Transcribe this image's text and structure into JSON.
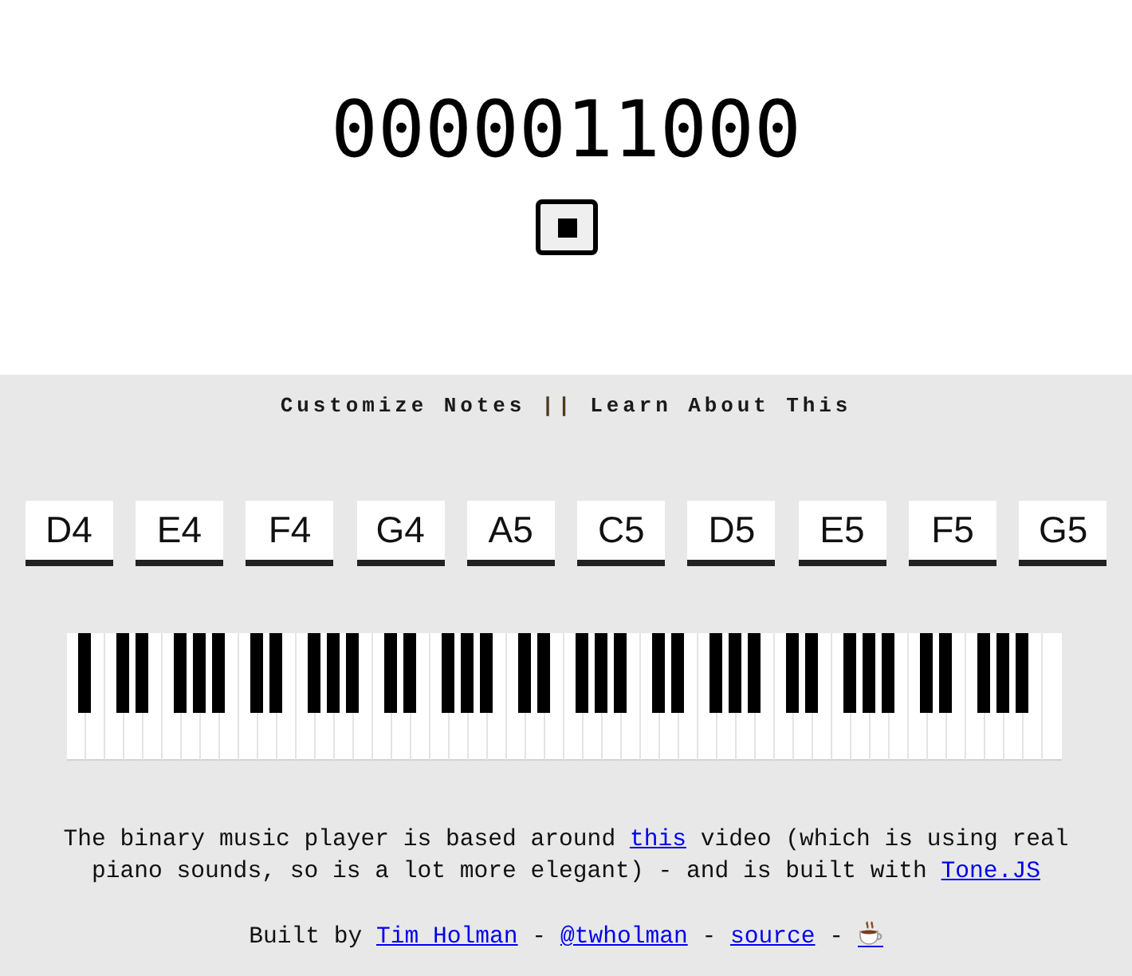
{
  "player": {
    "binary": "0000011000",
    "playing": true
  },
  "nav": [
    {
      "kind": "link",
      "label": "Customize Notes"
    },
    {
      "kind": "separator",
      "label": "||"
    },
    {
      "kind": "link",
      "label": "Learn About This"
    }
  ],
  "notes": [
    "D4",
    "E4",
    "F4",
    "G4",
    "A5",
    "C5",
    "D5",
    "E5",
    "F5",
    "G5"
  ],
  "piano": {
    "keys": [
      {
        "kind": "natural"
      },
      {
        "kind": "sharp"
      },
      {
        "kind": "natural"
      },
      {
        "kind": "natural"
      },
      {
        "kind": "sharp"
      },
      {
        "kind": "natural"
      },
      {
        "kind": "sharp"
      },
      {
        "kind": "natural"
      },
      {
        "kind": "natural"
      },
      {
        "kind": "sharp"
      },
      {
        "kind": "natural"
      },
      {
        "kind": "sharp"
      },
      {
        "kind": "natural"
      },
      {
        "kind": "sharp"
      },
      {
        "kind": "natural"
      },
      {
        "kind": "natural"
      },
      {
        "kind": "sharp"
      },
      {
        "kind": "natural"
      },
      {
        "kind": "sharp"
      },
      {
        "kind": "natural"
      },
      {
        "kind": "natural"
      },
      {
        "kind": "sharp"
      },
      {
        "kind": "natural"
      },
      {
        "kind": "sharp"
      },
      {
        "kind": "natural"
      },
      {
        "kind": "sharp"
      },
      {
        "kind": "natural"
      },
      {
        "kind": "natural"
      },
      {
        "kind": "sharp"
      },
      {
        "kind": "natural"
      },
      {
        "kind": "sharp"
      },
      {
        "kind": "natural"
      },
      {
        "kind": "natural"
      },
      {
        "kind": "sharp"
      },
      {
        "kind": "natural"
      },
      {
        "kind": "sharp"
      },
      {
        "kind": "natural"
      },
      {
        "kind": "sharp"
      },
      {
        "kind": "natural"
      },
      {
        "kind": "natural"
      },
      {
        "kind": "sharp"
      },
      {
        "kind": "natural"
      },
      {
        "kind": "sharp"
      },
      {
        "kind": "natural"
      },
      {
        "kind": "natural"
      },
      {
        "kind": "sharp"
      },
      {
        "kind": "natural"
      },
      {
        "kind": "sharp"
      },
      {
        "kind": "natural"
      },
      {
        "kind": "sharp"
      },
      {
        "kind": "natural"
      },
      {
        "kind": "natural"
      },
      {
        "kind": "sharp"
      },
      {
        "kind": "natural"
      },
      {
        "kind": "sharp"
      },
      {
        "kind": "natural"
      },
      {
        "kind": "natural"
      },
      {
        "kind": "sharp"
      },
      {
        "kind": "natural"
      },
      {
        "kind": "sharp"
      },
      {
        "kind": "natural"
      },
      {
        "kind": "sharp"
      },
      {
        "kind": "natural"
      },
      {
        "kind": "natural"
      },
      {
        "kind": "sharp"
      },
      {
        "kind": "natural"
      },
      {
        "kind": "sharp"
      },
      {
        "kind": "natural"
      },
      {
        "kind": "natural"
      },
      {
        "kind": "sharp"
      },
      {
        "kind": "natural"
      },
      {
        "kind": "sharp"
      },
      {
        "kind": "natural"
      },
      {
        "kind": "sharp"
      },
      {
        "kind": "natural"
      },
      {
        "kind": "natural"
      },
      {
        "kind": "sharp"
      },
      {
        "kind": "natural"
      },
      {
        "kind": "sharp"
      },
      {
        "kind": "natural"
      },
      {
        "kind": "natural"
      },
      {
        "kind": "sharp"
      },
      {
        "kind": "natural"
      },
      {
        "kind": "sharp"
      },
      {
        "kind": "natural"
      },
      {
        "kind": "sharp"
      },
      {
        "kind": "natural"
      },
      {
        "kind": "natural"
      }
    ]
  },
  "about": [
    {
      "kind": "text",
      "text": "The binary music player is based around "
    },
    {
      "kind": "link",
      "text": "this"
    },
    {
      "kind": "text",
      "text": " video (which is using real piano sounds, so is a lot more elegant) - and is built with "
    },
    {
      "kind": "link",
      "text": "Tone.JS"
    }
  ],
  "credits": [
    {
      "kind": "text",
      "text": "Built by "
    },
    {
      "kind": "link",
      "text": "Tim Holman"
    },
    {
      "kind": "text",
      "text": " - "
    },
    {
      "kind": "link",
      "text": "@twholman"
    },
    {
      "kind": "text",
      "text": " - "
    },
    {
      "kind": "link",
      "text": "source"
    },
    {
      "kind": "text",
      "text": " - "
    },
    {
      "kind": "icon_link"
    }
  ]
}
